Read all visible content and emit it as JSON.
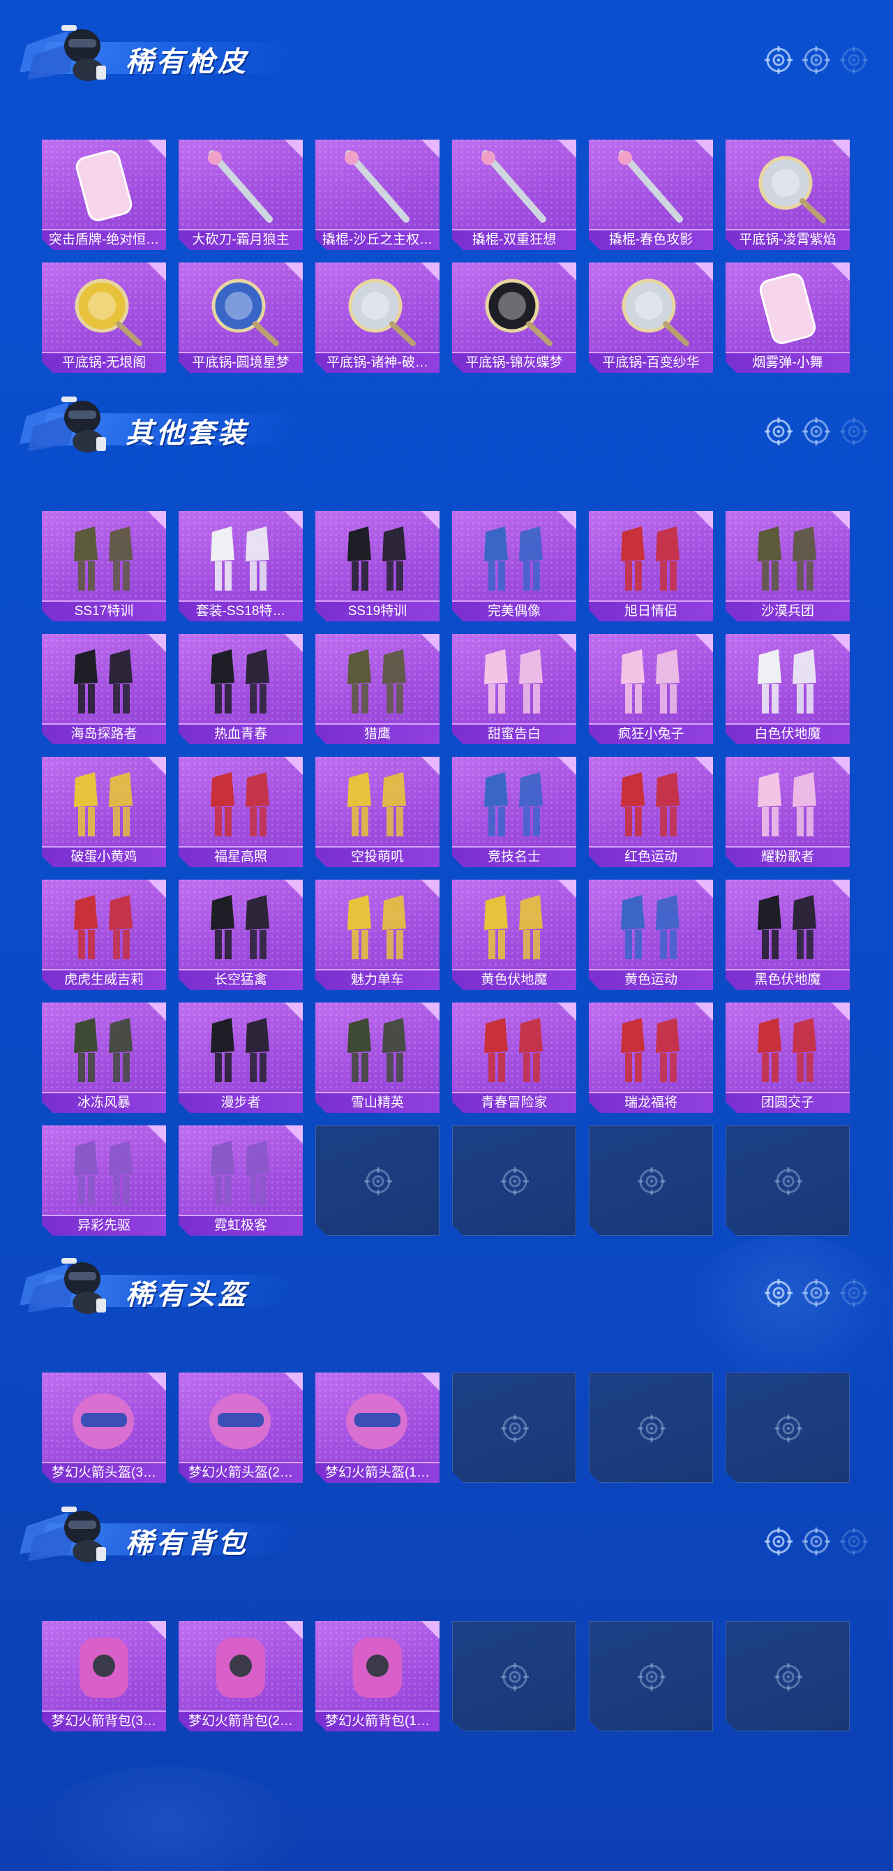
{
  "colors": {
    "background": "#0b4fd0",
    "item_bg": "#a24fe0",
    "item_label_bg": "#8a3ad8",
    "empty_slot": "#1d3f86",
    "title_text": "#ffffff"
  },
  "sections": [
    {
      "title": "稀有枪皮",
      "items": [
        {
          "label": "突击盾牌-绝对恒…",
          "icon": "shield-pink"
        },
        {
          "label": "大砍刀-霜月狼主",
          "icon": "machete"
        },
        {
          "label": "撬棍-沙丘之主权…",
          "icon": "crowbar-staff"
        },
        {
          "label": "撬棍-双重狂想",
          "icon": "crowbar-bat"
        },
        {
          "label": "撬棍-春色攻影",
          "icon": "crowbar-pinwheel"
        },
        {
          "label": "平底锅-凌霄紫焰",
          "icon": "pan-purple"
        },
        {
          "label": "平底锅-无垠阁",
          "icon": "pan-gold"
        },
        {
          "label": "平底锅-圆境星梦",
          "icon": "pan-blue"
        },
        {
          "label": "平底锅-诸神-破…",
          "icon": "pan-silver"
        },
        {
          "label": "平底锅-锦灰蝶梦",
          "icon": "pan-dark"
        },
        {
          "label": "平底锅-百变纱华",
          "icon": "pan-teal"
        },
        {
          "label": "烟雾弹-小舞",
          "icon": "grenade-anime"
        }
      ],
      "empty_slots": 0
    },
    {
      "title": "其他套装",
      "items": [
        {
          "label": "SS17特训",
          "icon": "outfit-camo"
        },
        {
          "label": "套装-SS18特…",
          "icon": "outfit-white-red"
        },
        {
          "label": "SS19特训",
          "icon": "outfit-black-gold"
        },
        {
          "label": "完美偶像",
          "icon": "outfit-idol"
        },
        {
          "label": "旭日情侣",
          "icon": "outfit-red"
        },
        {
          "label": "沙漠兵团",
          "icon": "outfit-desert"
        },
        {
          "label": "海岛探路者",
          "icon": "outfit-island"
        },
        {
          "label": "热血青春",
          "icon": "outfit-moto"
        },
        {
          "label": "猎鹰",
          "icon": "outfit-falcon"
        },
        {
          "label": "甜蜜告白",
          "icon": "outfit-sweet"
        },
        {
          "label": "疯狂小兔子",
          "icon": "outfit-bunny"
        },
        {
          "label": "白色伏地魔",
          "icon": "outfit-white-hoodie"
        },
        {
          "label": "破蛋小黄鸡",
          "icon": "outfit-chick"
        },
        {
          "label": "福星高照",
          "icon": "outfit-red-suit"
        },
        {
          "label": "空投萌叽",
          "icon": "outfit-yellow"
        },
        {
          "label": "竞技名士",
          "icon": "outfit-sport"
        },
        {
          "label": "红色运动",
          "icon": "outfit-red-sport"
        },
        {
          "label": "耀粉歌者",
          "icon": "outfit-pink-singer"
        },
        {
          "label": "虎虎生威吉莉",
          "icon": "outfit-tiger"
        },
        {
          "label": "长空猛禽",
          "icon": "outfit-raptor"
        },
        {
          "label": "魅力单车",
          "icon": "outfit-bike"
        },
        {
          "label": "黄色伏地魔",
          "icon": "outfit-yellow-hoodie"
        },
        {
          "label": "黄色运动",
          "icon": "outfit-yellow-sport"
        },
        {
          "label": "黑色伏地魔",
          "icon": "outfit-black-hoodie"
        },
        {
          "label": "冰冻风暴",
          "icon": "outfit-frost"
        },
        {
          "label": "漫步者",
          "icon": "outfit-walker"
        },
        {
          "label": "雪山精英",
          "icon": "outfit-snow"
        },
        {
          "label": "青春冒险家",
          "icon": "outfit-adventure"
        },
        {
          "label": "瑞龙福将",
          "icon": "outfit-dragon"
        },
        {
          "label": "团圆交子",
          "icon": "outfit-reunion"
        },
        {
          "label": "异彩先驱",
          "icon": "outfit-neon-mech"
        },
        {
          "label": "霓虹极客",
          "icon": "outfit-neon-geek"
        }
      ],
      "empty_slots": 4
    },
    {
      "title": "稀有头盔",
      "items": [
        {
          "label": "梦幻火箭头盔(3…",
          "icon": "helmet-lv3"
        },
        {
          "label": "梦幻火箭头盔(2…",
          "icon": "helmet-lv2"
        },
        {
          "label": "梦幻火箭头盔(1…",
          "icon": "helmet-lv1"
        }
      ],
      "empty_slots": 3
    },
    {
      "title": "稀有背包",
      "items": [
        {
          "label": "梦幻火箭背包(3…",
          "icon": "backpack-lv3"
        },
        {
          "label": "梦幻火箭背包(2…",
          "icon": "backpack-lv2"
        },
        {
          "label": "梦幻火箭背包(1…",
          "icon": "backpack-lv1"
        }
      ],
      "empty_slots": 3
    }
  ]
}
